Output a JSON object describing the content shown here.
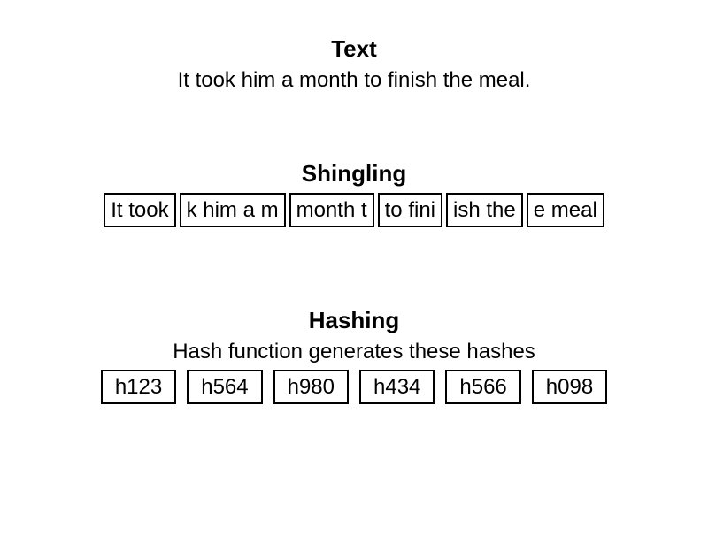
{
  "text": {
    "heading": "Text",
    "body": "It took him a month to finish the meal."
  },
  "shingling": {
    "heading": "Shingling",
    "items": [
      "It took",
      "k him a m",
      "month t",
      "to fini",
      "ish the",
      "e meal"
    ]
  },
  "hashing": {
    "heading": "Hashing",
    "subtitle": "Hash function generates these hashes",
    "items": [
      "h123",
      "h564",
      "h980",
      "h434",
      "h566",
      "h098"
    ]
  }
}
